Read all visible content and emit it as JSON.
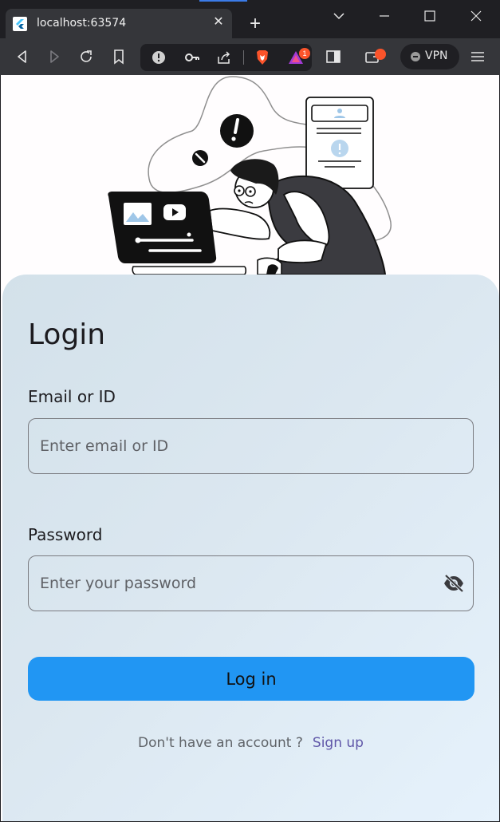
{
  "browser": {
    "tab_title": "localhost:63574",
    "vpn_label": "VPN",
    "notification_badge": "1"
  },
  "login": {
    "title": "Login",
    "email_label": "Email or ID",
    "email_placeholder": "Enter email or ID",
    "password_label": "Password",
    "password_placeholder": "Enter your password",
    "login_button": "Log in",
    "no_account_text": "Don't have an account ?",
    "signup_link": "Sign up"
  },
  "colors": {
    "primary": "#2196f3",
    "link": "#5f56a8",
    "card_start": "#d3e1ea",
    "card_end": "#e6f2fc"
  },
  "icons": [
    "flutter-icon",
    "close-icon",
    "plus-icon",
    "chevron-down-icon",
    "minimize-icon",
    "maximize-icon",
    "back-icon",
    "forward-icon",
    "reload-icon",
    "bookmark-icon",
    "info-icon",
    "key-icon",
    "share-icon",
    "brave-shield-icon",
    "brave-rewards-icon",
    "sidebar-icon",
    "wallet-icon",
    "menu-icon",
    "eye-off-icon"
  ]
}
